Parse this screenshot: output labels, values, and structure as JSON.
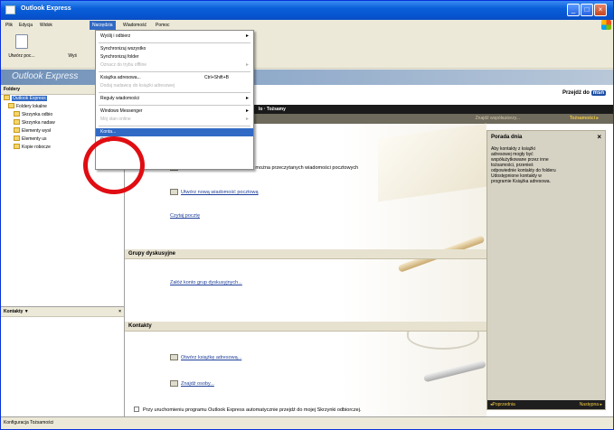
{
  "window": {
    "title": "Outlook Express"
  },
  "menubar": {
    "items": [
      "Plik",
      "Edycja",
      "Widok",
      "Narzędzia",
      "Wiadomość",
      "Pomoc"
    ]
  },
  "toolbar": {
    "buttons": [
      "Utwórz poc...",
      "Wyś"
    ]
  },
  "banner": {
    "text": "Outlook Express"
  },
  "folders": {
    "header": "Foldery",
    "items": [
      "Outlook Express",
      "Foldery lokalne",
      "Skrzynka odbio",
      "Skrzynka nadaw",
      "Elementy wysł",
      "Elementy us",
      "Kopie robocze"
    ]
  },
  "contacts": {
    "header": "Kontakty ▼",
    "close": "×"
  },
  "main": {
    "msn_link_prefix": "Przejdź do",
    "msn_badge": "msn",
    "darkbar_title": "lo · Tożsamy",
    "subbar_identity": "Znajdź współautorzy...",
    "subbar_id2": "Tożsamości ▸",
    "unread_text": "Nowy, zaprojektuj wiadomość nie można przeczytanych wiadomości pocztowych",
    "link_create_mail": "Utwórz nową wiadomość pocztową",
    "link_read_mail": "Czytaj pocztę",
    "section_newsgroups": "Grupy dyskusyjne",
    "link_newsgroup_setup": "Załóż konto grup dyskusyjnych...",
    "section_contacts": "Kontakty",
    "link_open_addressbook": "Otwórz książkę adresową...",
    "link_find_people": "Znajdź osoby...",
    "startup_checkbox_text": "Przy uruchomieniu programu Outlook Express automatycznie przejdź do mojej Skrzynki odbiorczej."
  },
  "tip": {
    "title": "Porada dnia",
    "close": "×",
    "body": "Aby kontakty z książki adresowej mogły być współużytkowane przez inne tożsamości, przenieś odpowiednie kontakty do folderu Udostępnione kontakty w programie Książka adresowa.",
    "prev": "◂Poprzednia",
    "next": "Następna ▸"
  },
  "statusbar": {
    "text": "Konfiguracja Tożsamości"
  },
  "dropdown": {
    "items": [
      {
        "label": "Wyślij i odbierz",
        "submenu": true,
        "disabled": false
      },
      {
        "label": "Synchronizuj wszystko",
        "disabled": false
      },
      {
        "label": "Synchronizuj folder",
        "disabled": false
      },
      {
        "label": "Oznacz do trybu offline",
        "submenu": true,
        "disabled": true
      },
      {
        "label": "Książka adresowa...",
        "shortcut": "Ctrl+Shift+B",
        "disabled": false
      },
      {
        "label": "Dodaj nadawcę do książki adresowej",
        "disabled": true
      },
      {
        "label": "Reguły wiadomości",
        "submenu": true,
        "disabled": false
      },
      {
        "label": "Windows Messenger",
        "submenu": true,
        "disabled": false
      },
      {
        "label": "Mój stan online",
        "submenu": true,
        "disabled": true
      },
      {
        "label": "Konta...",
        "disabled": false,
        "highlighted": true
      },
      {
        "label": "Opcje...",
        "disabled": false
      }
    ]
  },
  "colors": {
    "titlebar": "#0a5fd8",
    "highlight": "#316ac5",
    "annotation": "#e00d12"
  }
}
